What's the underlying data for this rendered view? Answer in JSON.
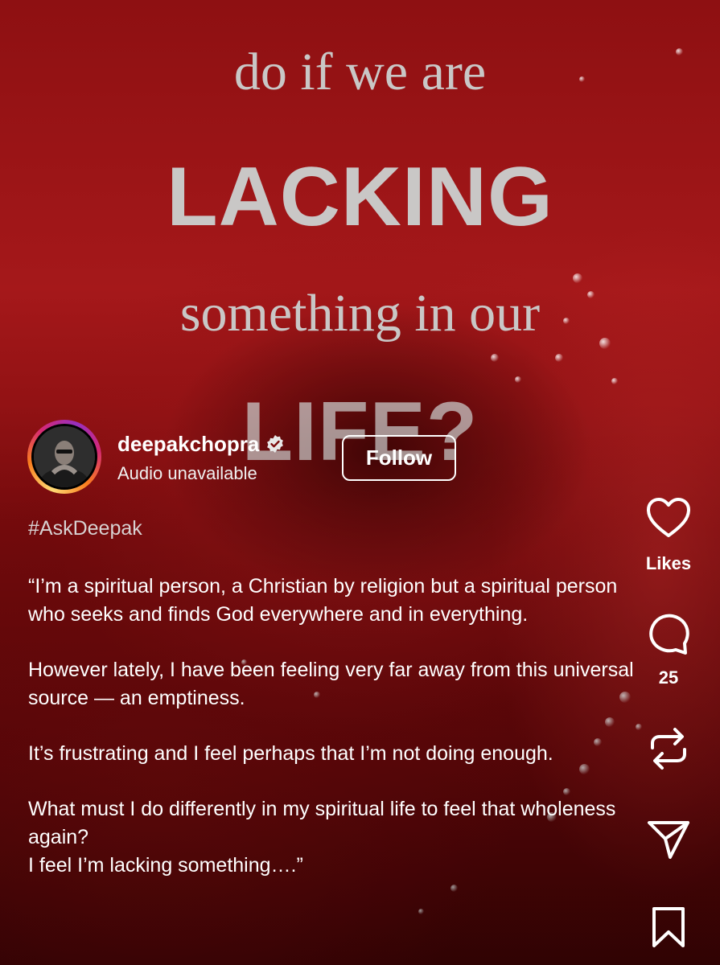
{
  "video_overlay": {
    "line1": "do if we are",
    "line2": "LACKING",
    "line3": "something in our",
    "line4": "LIFE?"
  },
  "author": {
    "username": "deepakchopra",
    "verified": true,
    "audio_status": "Audio unavailable",
    "follow_label": "Follow"
  },
  "post": {
    "hashtag": "#AskDeepak",
    "caption": [
      "“I’m a spiritual person, a Christian by religion but a spiritual person who seeks and finds God everywhere and in everything.",
      "However lately, I have been feeling very far away from this universal source — an emptiness.",
      "It’s frustrating and I feel perhaps that I’m not doing enough.",
      "What must I do differently in my spiritual life to feel that wholeness again?",
      "I feel I’m lacking something….”"
    ]
  },
  "actions": {
    "likes_label": "Likes",
    "comments_count": "25",
    "icons": [
      "heart-icon",
      "comment-icon",
      "repost-icon",
      "share-icon",
      "bookmark-icon"
    ]
  },
  "colors": {
    "overlay_text": "#c9c7c6",
    "background_red": "#8e1012",
    "story_ring": "#d62976"
  }
}
